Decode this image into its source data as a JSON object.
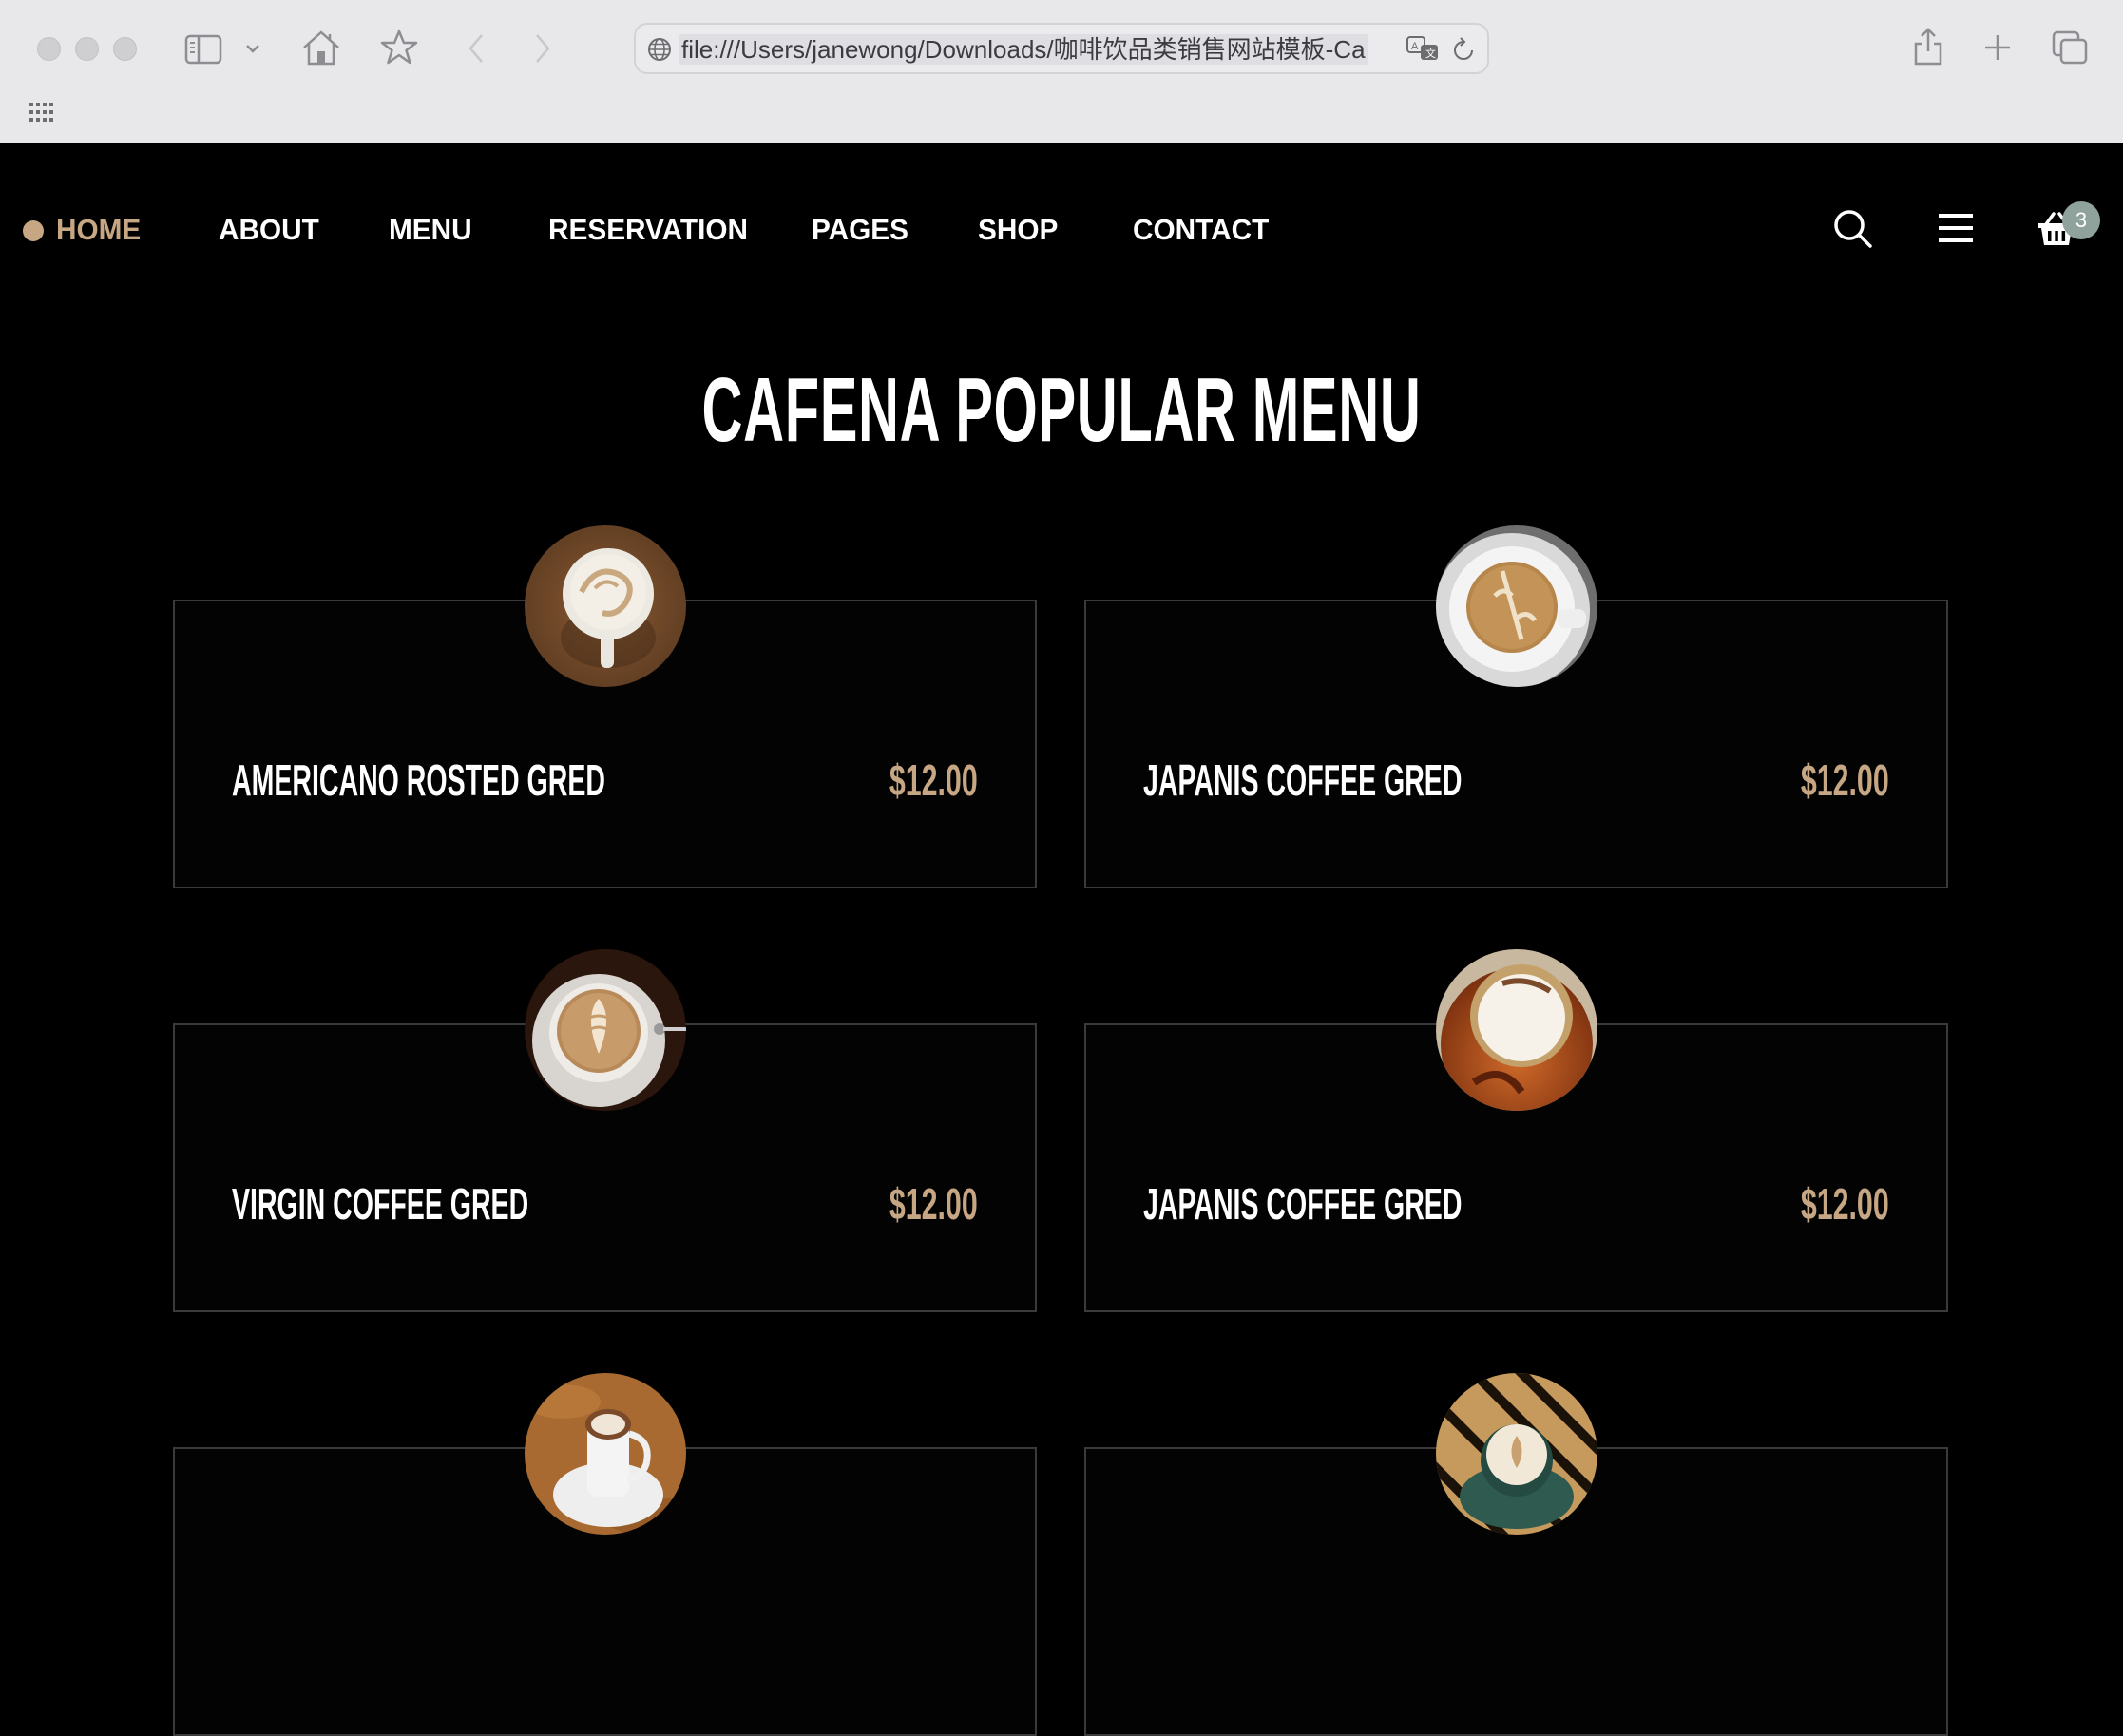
{
  "browser": {
    "url": "file:///Users/janewong/Downloads/咖啡饮品类销售网站模板-Ca",
    "icons": [
      "sidebar-icon",
      "chevron-down-icon",
      "home-icon",
      "star-icon",
      "back-icon",
      "forward-icon",
      "globe-icon",
      "translate-icon",
      "reload-icon",
      "share-icon",
      "new-tab-icon",
      "tabs-overview-icon",
      "apps-grid-icon"
    ]
  },
  "nav": {
    "items": [
      {
        "label": "HOME",
        "active": true
      },
      {
        "label": "ABOUT"
      },
      {
        "label": "MENU"
      },
      {
        "label": "RESERVATION"
      },
      {
        "label": "PAGES"
      },
      {
        "label": "SHOP"
      },
      {
        "label": "CONTACT"
      }
    ],
    "cart_count": "3"
  },
  "section": {
    "title": "CAFENA POPULAR MENU"
  },
  "menu_items": [
    {
      "name": "AMERICANO ROSTED GRED",
      "price": "$12.00",
      "image": "latte-cup-on-wood"
    },
    {
      "name": "JAPANIS COFFEE GRED",
      "price": "$12.00",
      "image": "latte-art-top-view"
    },
    {
      "name": "VIRGIN COFFEE GRED",
      "price": "$12.00",
      "image": "latte-art-with-spoon"
    },
    {
      "name": "JAPANIS COFFEE GRED",
      "price": "$12.00",
      "image": "cappuccino-orange-cup"
    },
    {
      "name": "",
      "price": "",
      "image": "cappuccino-tall-cup"
    },
    {
      "name": "",
      "price": "",
      "image": "coffee-green-cup"
    }
  ],
  "colors": {
    "accent": "#c7a783",
    "background": "#000000",
    "card_border": "#3a3a3c",
    "badge": "#8fa39c"
  }
}
